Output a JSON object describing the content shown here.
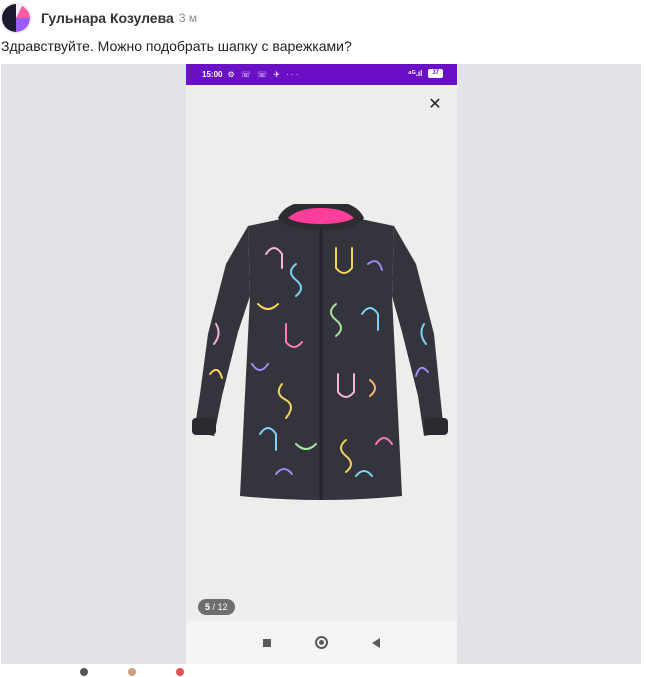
{
  "post": {
    "author": "Гульнара Козулева",
    "time": "3 м",
    "message": "Здравствуйте. Можно подобрать шапку с варежками?"
  },
  "phone": {
    "status_time": "15:00",
    "status_icons": "⚙ ☏ ☏ ✈ ···",
    "signal": "⁴ᴳ.ıl",
    "battery": "37",
    "close_icon": "✕",
    "page_current": "5",
    "page_total": "/ 12"
  },
  "colors": {
    "status_bar": "#6a11c6",
    "jacket": "#34343c",
    "hood_lining": "#ff3d9a"
  }
}
